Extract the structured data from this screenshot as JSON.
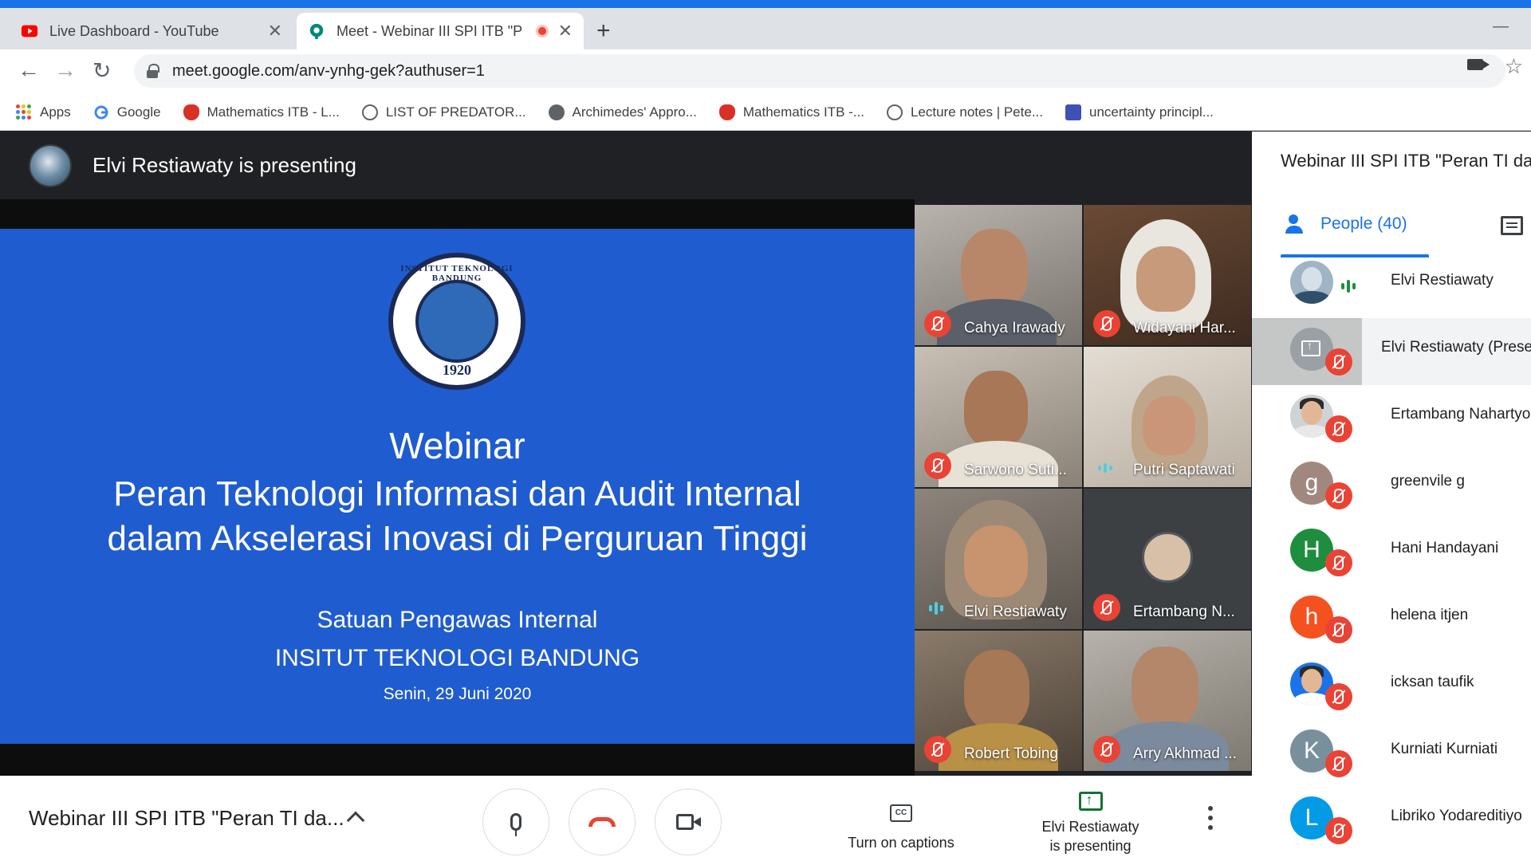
{
  "browser": {
    "tabs": [
      {
        "title": "Live Dashboard - YouTube",
        "close": "✕"
      },
      {
        "title": "Meet - Webinar III SPI ITB \"P",
        "close": "✕"
      }
    ],
    "new_tab": "+",
    "minimize": "—",
    "url": "meet.google.com/anv-ynhg-gek?authuser=1",
    "nav": {
      "back": "←",
      "forward": "→",
      "reload": "↻"
    },
    "star": "☆",
    "bookmarks": [
      {
        "label": "Apps",
        "icon": "apps-grid-icon"
      },
      {
        "label": "Google",
        "icon": "google-icon"
      },
      {
        "label": "Mathematics ITB - L...",
        "icon": "itb-icon"
      },
      {
        "label": "LIST OF PREDATOR...",
        "icon": "wordpress-icon"
      },
      {
        "label": "Archimedes' Appro...",
        "icon": "globe-icon"
      },
      {
        "label": "Mathematics ITB -...",
        "icon": "itb-icon"
      },
      {
        "label": "Lecture notes | Pete...",
        "icon": "wordpress-icon"
      },
      {
        "label": "uncertainty principl...",
        "icon": "shield-icon"
      }
    ]
  },
  "meet": {
    "presenting_banner": "Elvi Restiawaty is presenting",
    "slide": {
      "seal_year": "1920",
      "seal_ring": "INSTITUT TEKNOLOGI BANDUNG",
      "title": "Webinar",
      "subtitle_1": "Peran Teknologi Informasi dan Audit Internal",
      "subtitle_2": "dalam Akselerasi Inovasi di Perguruan Tinggi",
      "org_1": "Satuan Pengawas Internal",
      "org_2": "INSITUT TEKNOLOGI BANDUNG",
      "date": "Senin, 29 Juni 2020"
    },
    "tiles": [
      {
        "name": "Cahya Irawady",
        "muted": true
      },
      {
        "name": "Widayani Har...",
        "muted": true
      },
      {
        "name": "Sarwono Suti...",
        "muted": true
      },
      {
        "name": "Putri Saptawati",
        "muted": false
      },
      {
        "name": "Elvi Restiawaty",
        "muted": false
      },
      {
        "name": "Ertambang N...",
        "muted": true
      },
      {
        "name": "Robert Tobing",
        "muted": true
      },
      {
        "name": "Arry Akhmad ...",
        "muted": true
      }
    ],
    "bottom": {
      "meeting_title": "Webinar III SPI ITB \"Peran TI da...",
      "captions": "Turn on captions",
      "cc": "CC",
      "present_line1": "Elvi Restiawaty",
      "present_line2": "is presenting"
    },
    "panel": {
      "title": "Webinar III SPI ITB \"Peran TI da",
      "people_tab": "People (40)",
      "people": [
        {
          "name": "Elvi Restiawaty",
          "avatar": "photo",
          "speaking": true
        },
        {
          "name": "Elvi Restiawaty (Prese",
          "avatar": "presentation",
          "muted": true
        },
        {
          "name": "Ertambang Nahartyo",
          "avatar": "photo",
          "muted": true
        },
        {
          "name": "greenvile g",
          "initial": "g",
          "color": "#a1887f",
          "muted": true
        },
        {
          "name": "Hani Handayani",
          "initial": "H",
          "color": "#1e8e3e",
          "muted": true
        },
        {
          "name": "helena itjen",
          "initial": "h",
          "color": "#f4511e",
          "muted": true
        },
        {
          "name": "icksan taufik",
          "avatar": "photo",
          "muted": true
        },
        {
          "name": "Kurniati Kurniati",
          "initial": "K",
          "color": "#78909c",
          "muted": true
        },
        {
          "name": "Libriko Yodareditiyo",
          "initial": "L",
          "color": "#039be5",
          "muted": true
        }
      ]
    }
  },
  "colors": {
    "accent": "#1a73e8",
    "mute": "#ea4335",
    "slide_bg": "#1f5ccf"
  }
}
